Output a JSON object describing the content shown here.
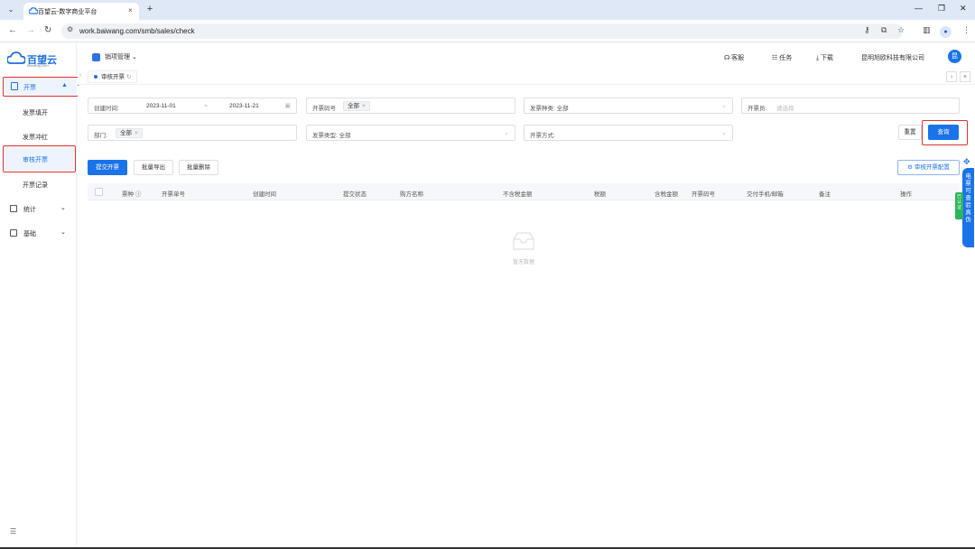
{
  "browser": {
    "tab_title": "百望云-数字商业平台",
    "url": "work.baiwang.com/smb/sales/check",
    "new_tab": "+",
    "tab_close": "×"
  },
  "sidebar": {
    "logo_name": "百望云",
    "logo_sub": "baiwang.com",
    "open_group": "开票",
    "sub_items": [
      "发票填开",
      "发票冲红",
      "审核开票",
      "开票记录"
    ],
    "active_sub": "审核开票",
    "groups": [
      "统计",
      "基础"
    ]
  },
  "header": {
    "product": "销项管理",
    "service": "客服",
    "tasks": "任务",
    "download": "下载",
    "company": "昆明旭欧科技有限公司",
    "avatar": "昆"
  },
  "tags": {
    "active": "审核开票"
  },
  "filters": {
    "create_time_label": "创建时间:",
    "date_start": "2023-11-01",
    "date_sep": "~",
    "date_end": "2023-11-21",
    "code_label": "开票码号",
    "code_chip": "全部",
    "invoice_kind": "发票种类: 全部",
    "issuer_label": "开票员:",
    "issuer_placeholder": "请选择",
    "dept_label": "部门:",
    "dept_chip": "全部",
    "invoice_type": "发票类型: 全部",
    "issue_method": "开票方式:",
    "reset": "重置",
    "query": "查询"
  },
  "actions": {
    "submit": "提交开票",
    "batch_export": "批量导出",
    "batch_delete": "批量删除",
    "config": "审核开票配置"
  },
  "table": {
    "columns": [
      "票种",
      "开票单号",
      "创建时间",
      "提交状态",
      "购方名称",
      "不含税金额",
      "税额",
      "含税金额",
      "开票码号",
      "交付手机/邮箱",
      "备注",
      "操作"
    ],
    "empty_text": "暂无数据"
  },
  "float": {
    "text": "电票可查验真伪",
    "green": "已认证"
  },
  "colors": {
    "primary": "#1a73e8",
    "highlight_box": "#e03131"
  }
}
